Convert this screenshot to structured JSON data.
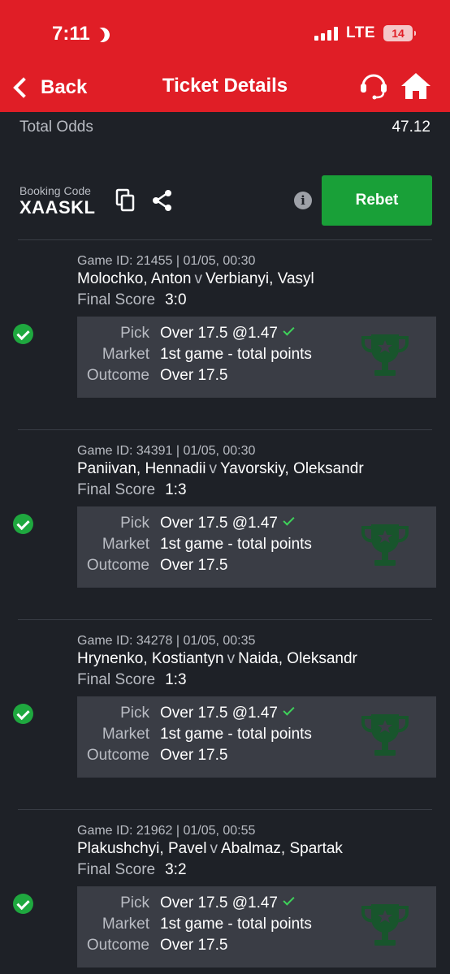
{
  "status_bar": {
    "time": "7:11",
    "network": "LTE",
    "battery": "14"
  },
  "header": {
    "back_label": "Back",
    "title": "Ticket Details",
    "support_icon": "headset-icon",
    "home_icon": "home-icon"
  },
  "summary": {
    "total_odds_label": "Total Odds",
    "total_odds_value": "47.12",
    "booking_label": "Booking Code",
    "booking_code": "XAASKL",
    "info_icon": "i",
    "rebet_label": "Rebet"
  },
  "labels": {
    "final_score": "Final Score",
    "pick": "Pick",
    "market": "Market",
    "outcome": "Outcome",
    "versus": "v"
  },
  "bets": [
    {
      "game_meta": "Game ID: 21455 | 01/05, 00:30",
      "player1": "Molochko, Anton",
      "player2": "Verbianyi, Vasyl",
      "final_score": "3:0",
      "pick": "Over 17.5 @1.47",
      "market": "1st game - total points",
      "outcome": "Over 17.5",
      "status": "won"
    },
    {
      "game_meta": "Game ID: 34391 | 01/05, 00:30",
      "player1": "Paniivan, Hennadii",
      "player2": "Yavorskiy, Oleksandr",
      "final_score": "1:3",
      "pick": "Over 17.5 @1.47",
      "market": "1st game - total points",
      "outcome": "Over 17.5",
      "status": "won"
    },
    {
      "game_meta": "Game ID: 34278 | 01/05, 00:35",
      "player1": "Hrynenko, Kostiantyn",
      "player2": "Naida, Oleksandr",
      "final_score": "1:3",
      "pick": "Over 17.5 @1.47",
      "market": "1st game - total points",
      "outcome": "Over 17.5",
      "status": "won"
    },
    {
      "game_meta": "Game ID: 21962 | 01/05, 00:55",
      "player1": "Plakushchyi, Pavel",
      "player2": "Abalmaz, Spartak",
      "final_score": "3:2",
      "pick": "Over 17.5 @1.47",
      "market": "1st game - total points",
      "outcome": "Over 17.5",
      "status": "won"
    }
  ],
  "colors": {
    "header_red": "#e01e26",
    "background": "#1e2127",
    "rebet_green": "#19a038",
    "win_green": "#1fa83f",
    "pick_box": "#3a3d45"
  }
}
